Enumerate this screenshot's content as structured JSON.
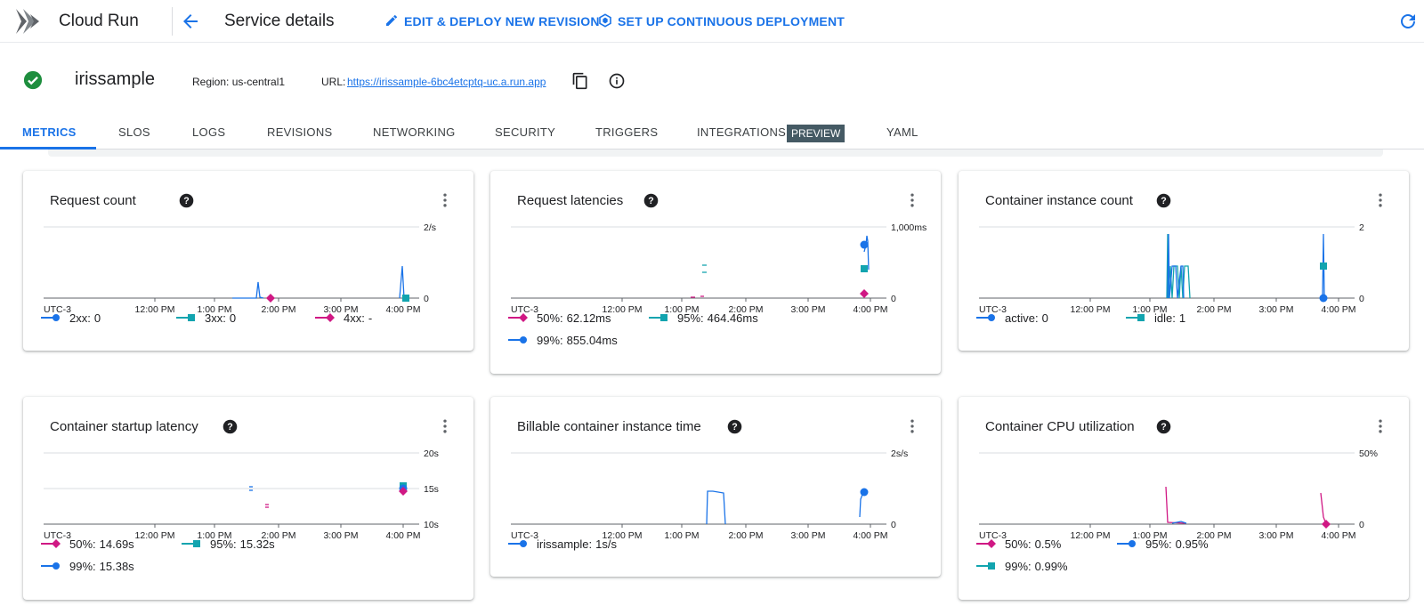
{
  "topbar": {
    "app_name": "Cloud Run",
    "page_title": "Service details",
    "edit_label": "EDIT & DEPLOY NEW REVISION",
    "cd_label": "SET UP CONTINUOUS DEPLOYMENT"
  },
  "service": {
    "name": "irissample",
    "region_label": "Region: us-central1",
    "url_label": "URL:",
    "url": "https://irissample-6bc4etcptq-uc.a.run.app"
  },
  "tabs": [
    "METRICS",
    "SLOS",
    "LOGS",
    "REVISIONS",
    "NETWORKING",
    "SECURITY",
    "TRIGGERS",
    "INTEGRATIONS",
    "YAML"
  ],
  "preview_badge": "PREVIEW",
  "colors": {
    "blue": "#1a73e8",
    "teal": "#12a4af",
    "magenta": "#d01884",
    "accent": "#1a73e8",
    "grid": "#dadce0"
  },
  "x_ticks": [
    "UTC-3",
    "12:00 PM",
    "1:00 PM",
    "2:00 PM",
    "3:00 PM",
    "4:00 PM"
  ],
  "cards": [
    {
      "title": "Request count",
      "y_ticks": [
        "2/s",
        "0"
      ],
      "legend": [
        {
          "label": "2xx:",
          "value": "0",
          "color": "blue",
          "marker": "circle"
        },
        {
          "label": "3xx:",
          "value": "0",
          "color": "teal",
          "marker": "square"
        },
        {
          "label": "4xx:",
          "value": "-",
          "color": "magenta",
          "marker": "diamond"
        }
      ]
    },
    {
      "title": "Request latencies",
      "y_ticks": [
        "1,000ms",
        "0"
      ],
      "legend": [
        {
          "label": "50%:",
          "value": "62.12ms",
          "color": "magenta",
          "marker": "diamond"
        },
        {
          "label": "95%:",
          "value": "464.46ms",
          "color": "teal",
          "marker": "square"
        },
        {
          "label": "99%:",
          "value": "855.04ms",
          "color": "blue",
          "marker": "circle"
        }
      ]
    },
    {
      "title": "Container instance count",
      "y_ticks": [
        "2",
        "0"
      ],
      "legend": [
        {
          "label": "active:",
          "value": "0",
          "color": "blue",
          "marker": "circle"
        },
        {
          "label": "idle:",
          "value": "1",
          "color": "teal",
          "marker": "square"
        }
      ]
    },
    {
      "title": "Container startup latency",
      "y_ticks": [
        "20s",
        "15s",
        "10s"
      ],
      "legend": [
        {
          "label": "50%:",
          "value": "14.69s",
          "color": "magenta",
          "marker": "diamond"
        },
        {
          "label": "95%:",
          "value": "15.32s",
          "color": "teal",
          "marker": "square"
        },
        {
          "label": "99%:",
          "value": "15.38s",
          "color": "blue",
          "marker": "circle"
        }
      ]
    },
    {
      "title": "Billable container instance time",
      "y_ticks": [
        "2s/s",
        "0"
      ],
      "legend": [
        {
          "label": "irissample:",
          "value": "1s/s",
          "color": "blue",
          "marker": "circle"
        }
      ]
    },
    {
      "title": "Container CPU utilization",
      "y_ticks": [
        "50%",
        "0"
      ],
      "legend": [
        {
          "label": "50%:",
          "value": "0.5%",
          "color": "magenta",
          "marker": "diamond"
        },
        {
          "label": "95%:",
          "value": "0.95%",
          "color": "blue",
          "marker": "circle"
        },
        {
          "label": "99%:",
          "value": "0.99%",
          "color": "teal",
          "marker": "square"
        }
      ]
    }
  ]
}
